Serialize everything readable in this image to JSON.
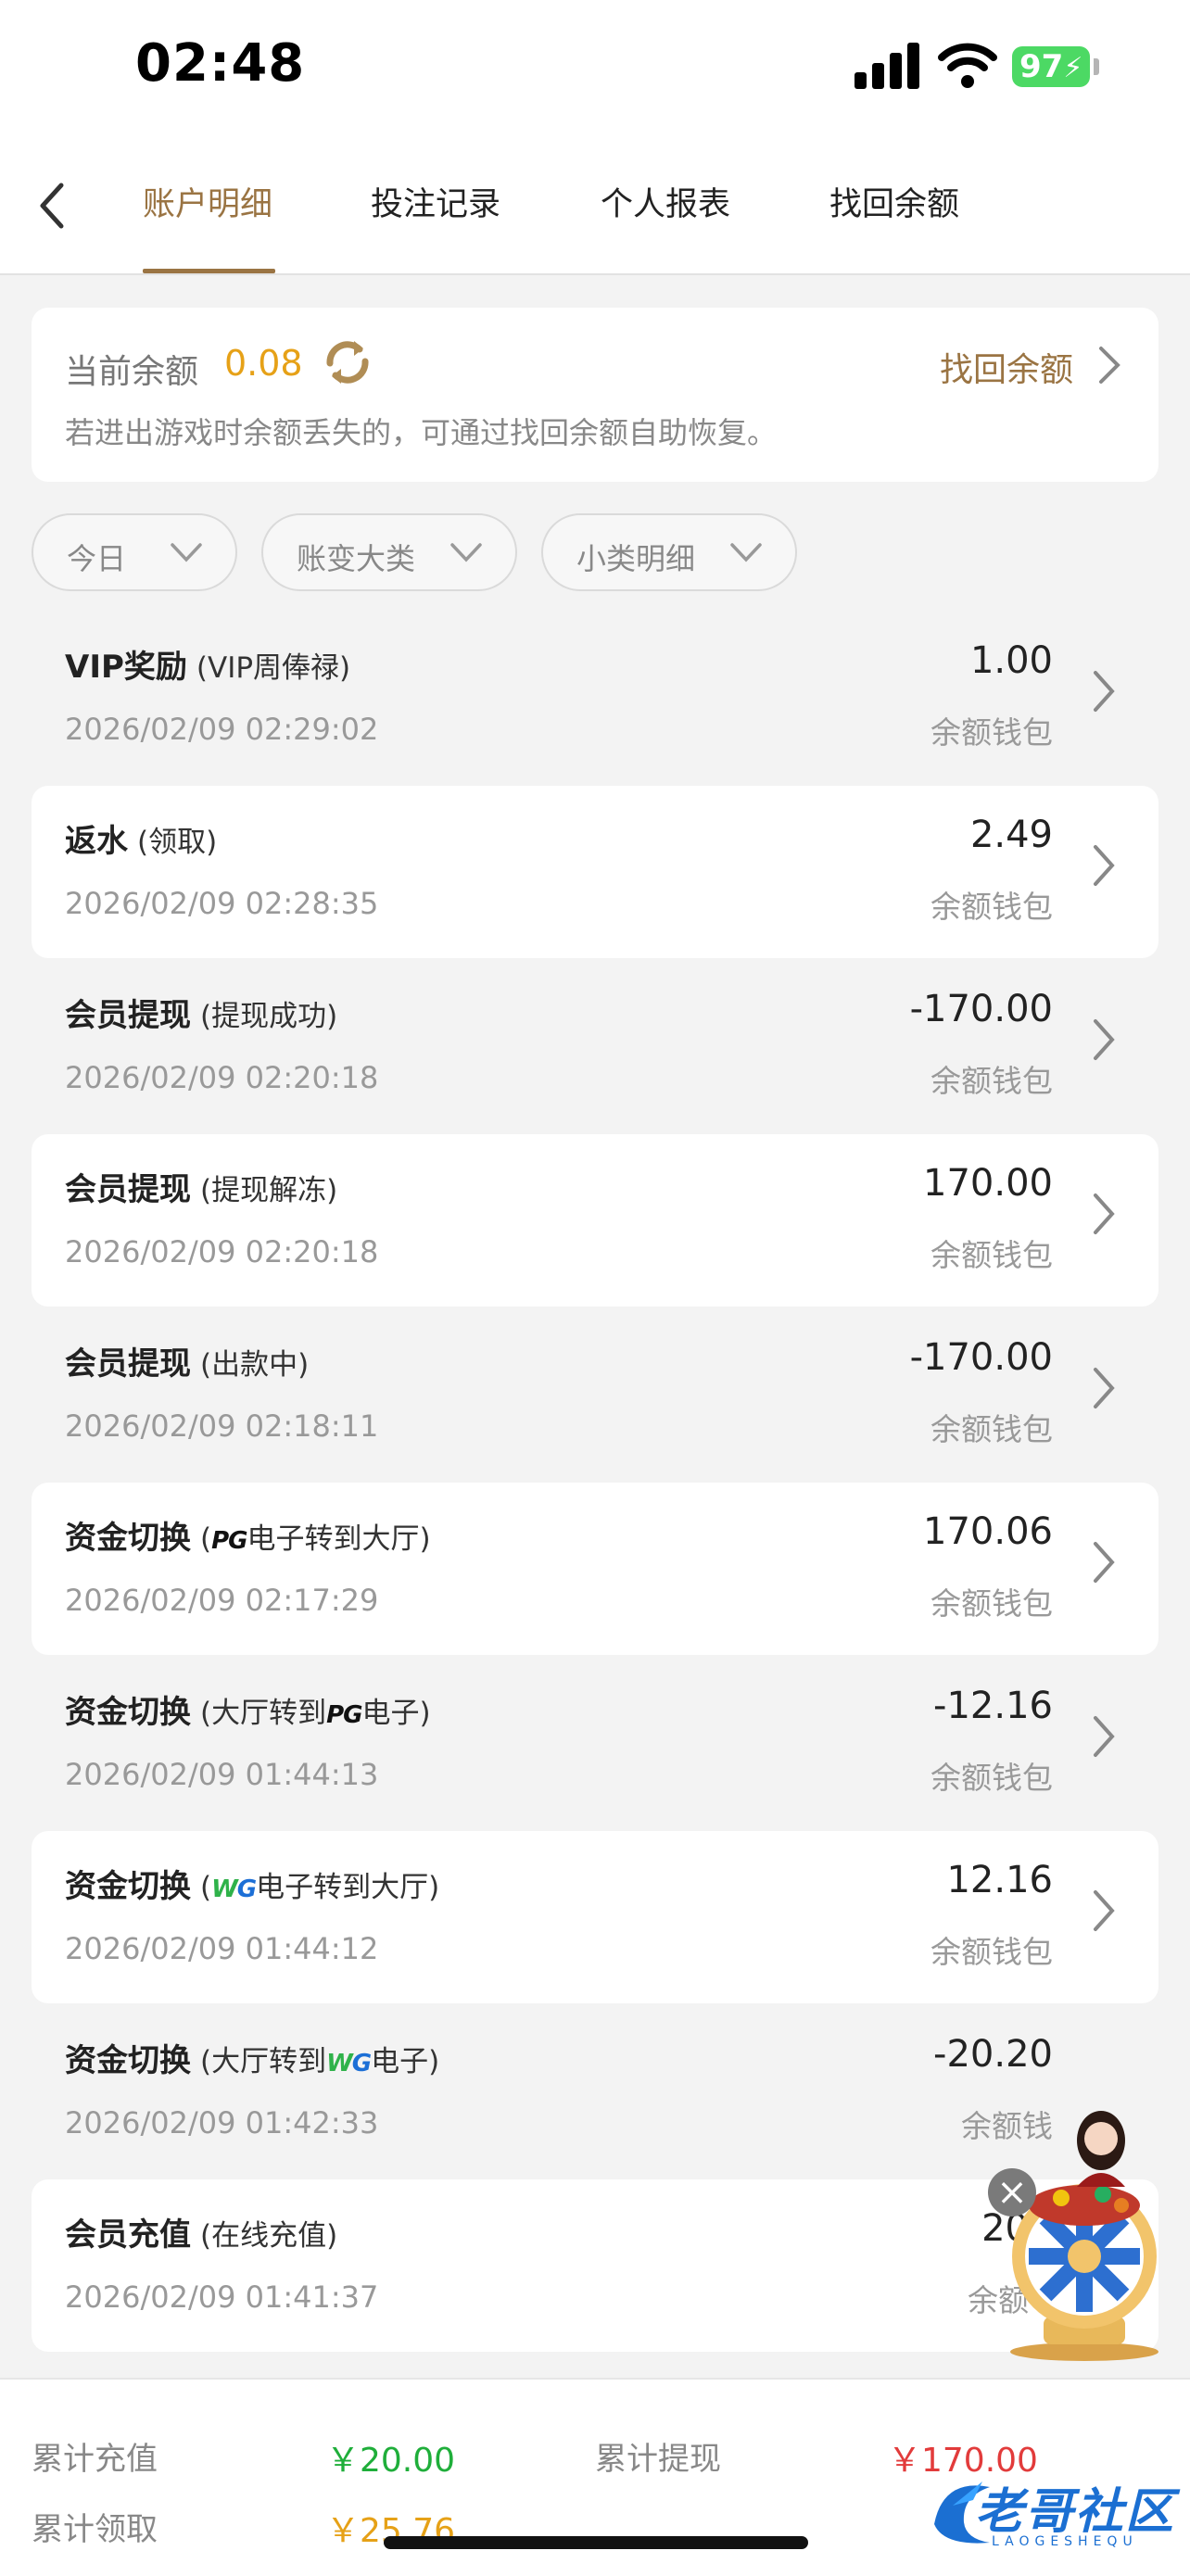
{
  "status": {
    "time": "02:48",
    "battery": "97"
  },
  "tabs": [
    {
      "label": "账户明细"
    },
    {
      "label": "投注记录"
    },
    {
      "label": "个人报表"
    },
    {
      "label": "找回余额"
    }
  ],
  "balance": {
    "label": "当前余额",
    "value": "0.08",
    "recover_link": "找回余额",
    "hint": "若进出游戏时余额丢失的，可通过找回余额自助恢复。"
  },
  "filters": [
    {
      "label": "今日"
    },
    {
      "label": "账变大类"
    },
    {
      "label": "小类明细"
    }
  ],
  "records": [
    {
      "title": "VIP奖励",
      "sub": "(VIP周俸禄)",
      "time": "2026/02/09 02:29:02",
      "amount": "1.00",
      "wallet": "余额钱包"
    },
    {
      "title": "返水",
      "sub": "(领取)",
      "time": "2026/02/09 02:28:35",
      "amount": "2.49",
      "wallet": "余额钱包"
    },
    {
      "title": "会员提现",
      "sub": "(提现成功)",
      "time": "2026/02/09 02:20:18",
      "amount": "-170.00",
      "wallet": "余额钱包"
    },
    {
      "title": "会员提现",
      "sub": "(提现解冻)",
      "time": "2026/02/09 02:20:18",
      "amount": "170.00",
      "wallet": "余额钱包"
    },
    {
      "title": "会员提现",
      "sub": "(出款中)",
      "time": "2026/02/09 02:18:11",
      "amount": "-170.00",
      "wallet": "余额钱包"
    },
    {
      "title": "资金切换",
      "sub_pre": "(",
      "sub_logo": "PG",
      "sub_post": "电子转到大厅)",
      "time": "2026/02/09 02:17:29",
      "amount": "170.06",
      "wallet": "余额钱包"
    },
    {
      "title": "资金切换",
      "sub_pre": "(大厅转到",
      "sub_logo": "PG",
      "sub_post": "电子)",
      "time": "2026/02/09 01:44:13",
      "amount": "-12.16",
      "wallet": "余额钱包"
    },
    {
      "title": "资金切换",
      "sub_pre": "(",
      "sub_logo": "WG",
      "sub_post": "电子转到大厅)",
      "time": "2026/02/09 01:44:12",
      "amount": "12.16",
      "wallet": "余额钱包"
    },
    {
      "title": "资金切换",
      "sub_pre": "(大厅转到",
      "sub_logo": "WG",
      "sub_post": "电子)",
      "time": "2026/02/09 01:42:33",
      "amount": "-20.20",
      "wallet": "余额钱"
    },
    {
      "title": "会员充值",
      "sub": "(在线充值)",
      "time": "2026/02/09 01:41:37",
      "amount": "20",
      "wallet": "余额"
    }
  ],
  "footer": {
    "recharge_label": "累计充值",
    "recharge_value": "￥20.00",
    "withdraw_label": "累计提现",
    "withdraw_value": "￥170.00",
    "claim_label": "累计领取",
    "claim_value": "￥25.76"
  },
  "brand": {
    "name": "老哥社区",
    "sub": "LAOGESHEQU"
  },
  "colors": {
    "accent": "#9a7443",
    "gold": "#e6a117",
    "green": "#1fae3a",
    "red": "#e23b3b"
  }
}
